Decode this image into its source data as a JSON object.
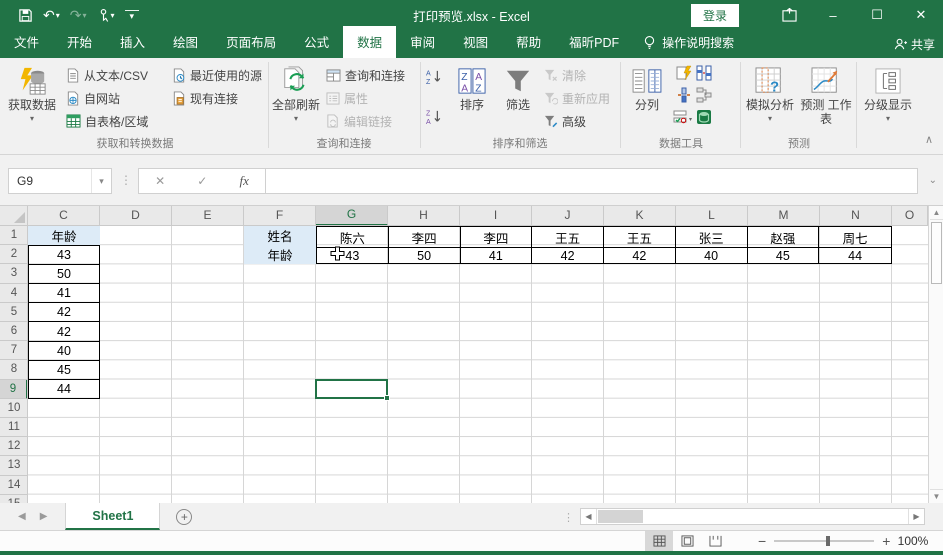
{
  "window": {
    "title": "打印预览.xlsx  -  Excel",
    "sign_in": "登录",
    "minimize": "–",
    "maximize": "☐",
    "close": "✕",
    "accent_color": "#217346"
  },
  "qat": {
    "save": "save",
    "undo": "↶",
    "redo": "↷",
    "touch_mode": "touch-mode",
    "customize": "▾"
  },
  "tabs": {
    "items": [
      "文件",
      "开始",
      "插入",
      "绘图",
      "页面布局",
      "公式",
      "数据",
      "审阅",
      "视图",
      "帮助",
      "福昕PDF"
    ],
    "active": "数据",
    "tell_me": "操作说明搜索",
    "share": "共享"
  },
  "ribbon": {
    "get_data": {
      "label": "获取和转换数据",
      "big": "获取数据",
      "items": [
        "从文本/CSV",
        "自网站",
        "自表格/区域",
        "最近使用的源",
        "现有连接"
      ]
    },
    "queries": {
      "label": "查询和连接",
      "big": "全部刷新",
      "items": [
        "查询和连接",
        "属性",
        "编辑链接"
      ]
    },
    "sort_filter": {
      "label": "排序和筛选",
      "sort": "排序",
      "filter": "筛选",
      "items": [
        "清除",
        "重新应用",
        "高级"
      ]
    },
    "data_tools": {
      "label": "数据工具",
      "big": "分列"
    },
    "forecast": {
      "label": "预测",
      "what_if": "模拟分析",
      "forecast_sheet": "预测 工作表"
    },
    "outline": {
      "big": "分级显示"
    }
  },
  "formula_bar": {
    "name_box": "G9",
    "cancel": "✕",
    "enter": "✓",
    "insert_function": "fx",
    "formula": ""
  },
  "sheet": {
    "columns": [
      "C",
      "D",
      "E",
      "F",
      "G",
      "H",
      "I",
      "J",
      "K",
      "L",
      "M",
      "N"
    ],
    "partial_column": "O",
    "selected_column": "G",
    "selected_row": 9,
    "selected_cell": "G9",
    "row_count": 15,
    "c_header": "年龄",
    "c_values": [
      "43",
      "50",
      "41",
      "42",
      "42",
      "40",
      "45",
      "44"
    ],
    "f_labels": [
      "姓名",
      "年龄"
    ],
    "names": [
      "陈六",
      "李四",
      "李四",
      "王五",
      "王五",
      "张三",
      "赵强",
      "周七"
    ],
    "ages": [
      "43",
      "50",
      "41",
      "42",
      "42",
      "40",
      "45",
      "44"
    ],
    "fill_color": "#DDEBF7"
  },
  "sheet_tabs": {
    "active": "Sheet1",
    "add": "+"
  },
  "status_bar": {
    "zoom": "100%"
  }
}
